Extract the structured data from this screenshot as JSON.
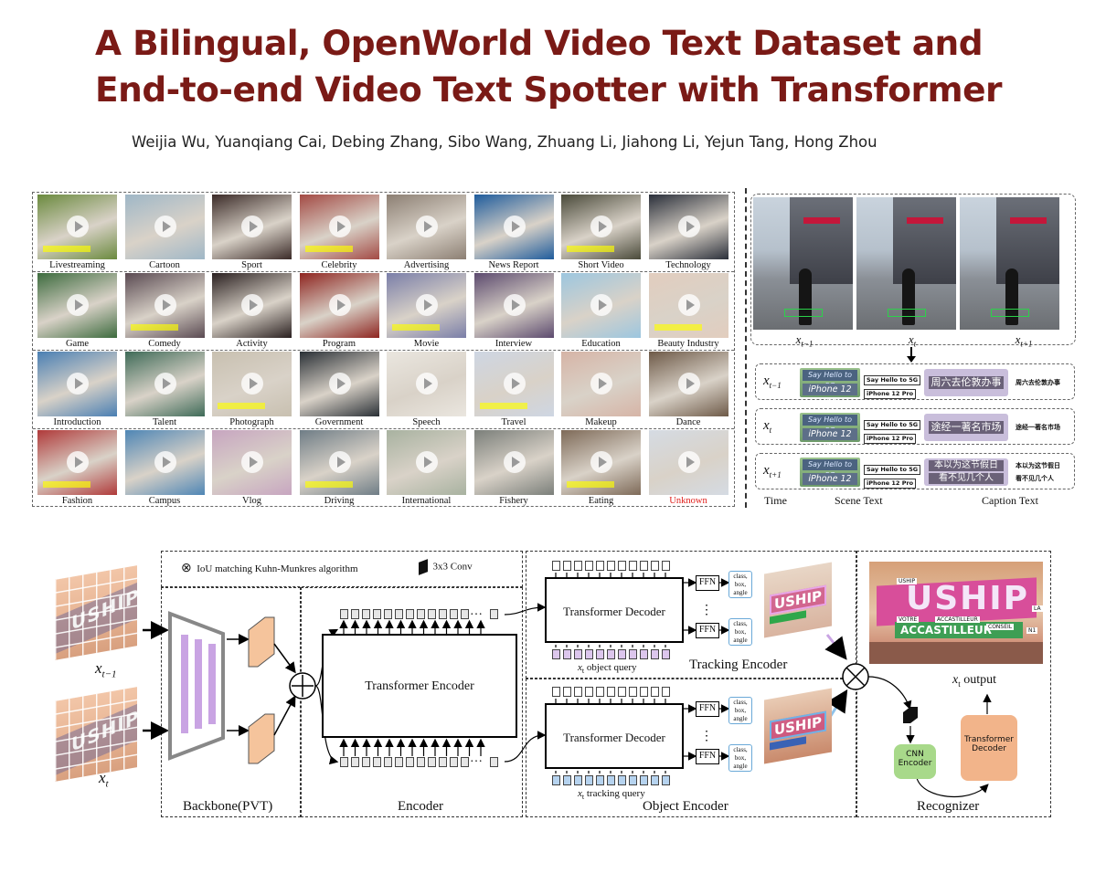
{
  "title_line1": "A Bilingual, OpenWorld Video Text Dataset and",
  "title_line2": "End-to-end Video Text Spotter with Transformer",
  "authors": "Weijia Wu, Yuanqiang Cai, Debing Zhang, Sibo Wang, Zhuang Li, Jiahong Li, Yejun Tang, Hong Zhou",
  "categories": [
    "Livestreaming",
    "Cartoon",
    "Sport",
    "Celebrity",
    "Advertising",
    "News Report",
    "Short Video",
    "Technology",
    "Game",
    "Comedy",
    "Activity",
    "Program",
    "Movie",
    "Interview",
    "Education",
    "Beauty Industry",
    "Introduction",
    "Talent",
    "Photograph",
    "Government",
    "Speech",
    "Travel",
    "Makeup",
    "Dance",
    "Fashion",
    "Campus",
    "Vlog",
    "Driving",
    "International",
    "Fishery",
    "Eating",
    "Unknown"
  ],
  "thumb_colors": [
    "#6b8a3e",
    "#9fb7c7",
    "#3b2b28",
    "#a34a44",
    "#8c7f73",
    "#1f5c9c",
    "#4a4a3a",
    "#2a2f3a",
    "#3d6b3e",
    "#5a4a52",
    "#2a2020",
    "#8e2520",
    "#7a7ea8",
    "#5c4a6e",
    "#9cc6df",
    "#e2cdbe",
    "#4a7fb3",
    "#3f6b58",
    "#c8c0b0",
    "#2a3036",
    "#eae6df",
    "#ced6e3",
    "#d6b4a6",
    "#6e5a48",
    "#b03a3a",
    "#4f86b5",
    "#c7a5c0",
    "#6f7d86",
    "#a8b2a0",
    "#7b7f7a",
    "#7e6a58",
    "#d5dbe3"
  ],
  "frame_labels": [
    "x",
    "x",
    "x"
  ],
  "frame_subs": [
    "t−1",
    "t",
    "t+1"
  ],
  "track_rows": [
    {
      "x": "x",
      "sub": "t−1",
      "scene_big1": "Say Hello to 5G",
      "scene_big2": "iPhone 12 Pro",
      "scene_t1": "Say Hello to 5G",
      "scene_t2": "iPhone 12 Pro",
      "cap_img": "周六去伦敦办事",
      "cap_text": "周六去伦敦办事"
    },
    {
      "x": "x",
      "sub": "t",
      "scene_big1": "Say Hello to 5G",
      "scene_big2": "iPhone 12 Pro",
      "scene_t1": "Say Hello to 5G",
      "scene_t2": "iPhone 12 Pro",
      "cap_img": "途经一著名市场",
      "cap_text": "途经一著名市场"
    },
    {
      "x": "x",
      "sub": "t+1",
      "scene_big1": "Say Hello to 5G",
      "scene_big2": "iPhone 12 Pro",
      "scene_t1": "Say Hello to 5G",
      "scene_t2": "iPhone 12 Pro",
      "cap_img1": "本以为这节假日",
      "cap_img2": "看不见几个人",
      "cap_text1": "本以为这节假日",
      "cap_text2": "看不见几个人"
    }
  ],
  "col_labels": {
    "time": "Time",
    "scene": "Scene Text",
    "caption": "Caption Text"
  },
  "diagram": {
    "legend_iou": "IoU matching Kuhn-Munkres algorithm",
    "legend_conv": "3x3  Conv",
    "input_top": "x",
    "input_top_sub": "t−1",
    "input_bottom": "x",
    "input_bottom_sub": "t",
    "frame_text": "USHIP",
    "backbone": "Backbone(PVT)",
    "transformer_encoder": "Transformer Encoder",
    "encoder": "Encoder",
    "transformer_decoder": "Transformer Decoder",
    "ffn": "FFN",
    "cba": "class,\nbox,\nangle",
    "object_query": "object query",
    "tracking_query": "tracking query",
    "query_prefix": "x",
    "query_sub": "t",
    "tracking_encoder": "Tracking Encoder",
    "object_encoder": "Object Encoder",
    "output": "output",
    "output_var": "x",
    "output_sub": "t",
    "cnn_encoder": "CNN Encoder",
    "recog_decoder": "Transformer Decoder",
    "recognizer": "Recognizer",
    "uship_labels": [
      "USHIP",
      "VOTRE",
      "ACCASTILLEUR",
      "CONSEIL",
      "LA",
      "N1",
      "ACCASTILLEUR"
    ]
  }
}
